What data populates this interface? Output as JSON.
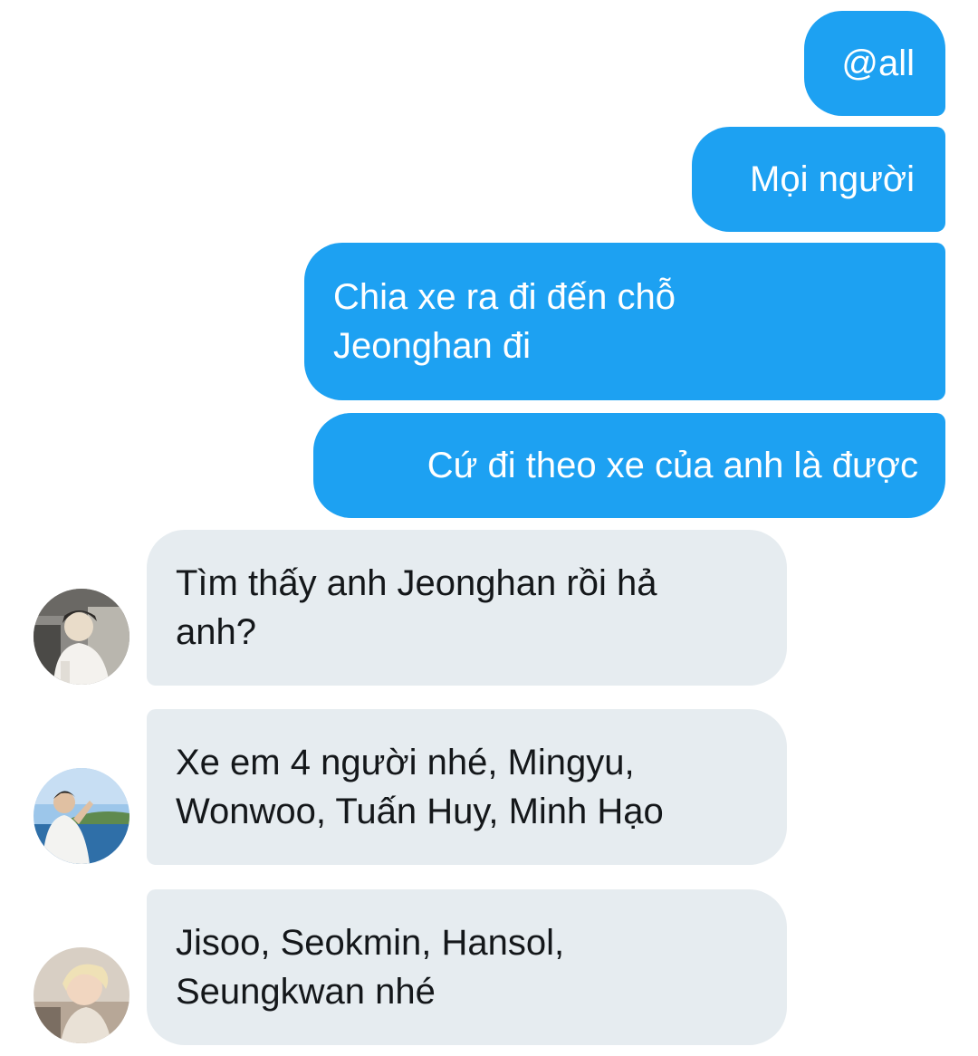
{
  "messages": {
    "outgoing": [
      {
        "text": "@all"
      },
      {
        "text": "Mọi người"
      },
      {
        "line1": "Chia xe ra đi đến chỗ",
        "line2": "Jeonghan đi"
      },
      {
        "text": "Cứ đi theo xe của anh là được"
      }
    ],
    "incoming": [
      {
        "line1": "Tìm thấy anh Jeonghan rồi hả",
        "line2": "anh?"
      },
      {
        "line1": "Xe em 4 người nhé, Mingyu,",
        "line2": "Wonwoo, Tuấn Huy, Minh Hạo"
      },
      {
        "line1": "Jisoo, Seokmin, Hansol,",
        "line2": "Seungkwan nhé"
      }
    ]
  },
  "colors": {
    "outgoing_bubble": "#1da1f2",
    "incoming_bubble": "#e6ecf0",
    "incoming_text": "#14171a",
    "background": "#ffffff"
  },
  "icons": {
    "avatar_1": "user-avatar-photo-white-shirt-indoor",
    "avatar_2": "user-avatar-photo-seaside",
    "avatar_3": "user-avatar-photo-blond-hair"
  }
}
